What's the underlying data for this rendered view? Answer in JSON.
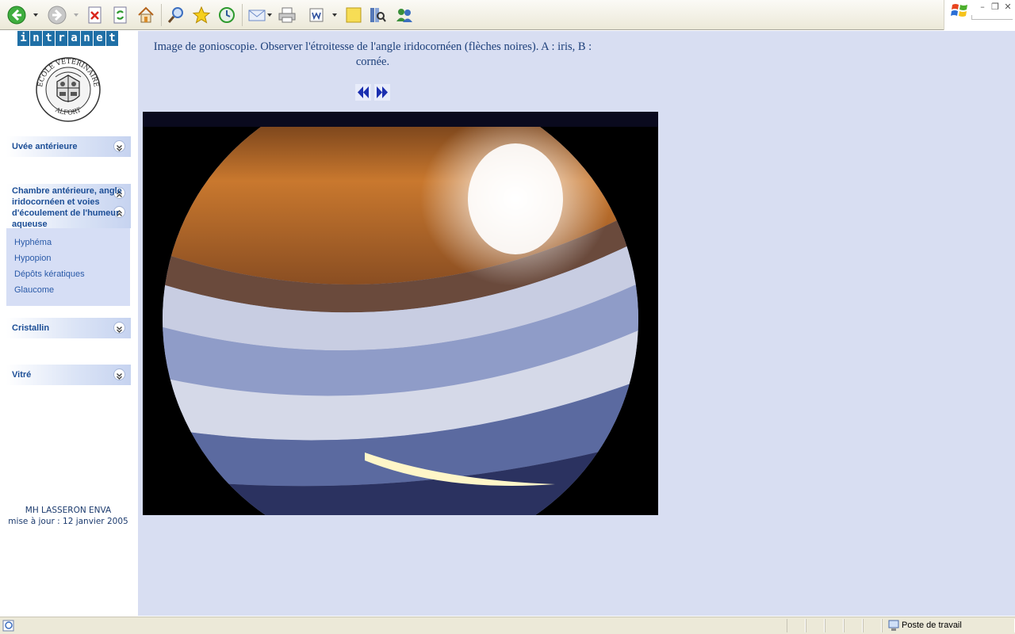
{
  "toolbar": {
    "buttons": [
      {
        "id": "back",
        "icon": "back-arrow-icon",
        "color": "#2e9a2e"
      },
      {
        "id": "forward",
        "icon": "forward-arrow-icon",
        "color": "#8c8c8c"
      },
      {
        "id": "stop",
        "icon": "stop-icon",
        "color": "#d9261c"
      },
      {
        "id": "refresh",
        "icon": "refresh-icon",
        "color": "#2e9a2e"
      },
      {
        "id": "home",
        "icon": "home-icon",
        "color": "#d98c2b"
      },
      {
        "id": "search",
        "icon": "search-icon",
        "color": "#3c6fc0"
      },
      {
        "id": "favorites",
        "icon": "star-icon",
        "color": "#f2c200"
      },
      {
        "id": "history",
        "icon": "history-icon",
        "color": "#2e9a2e"
      },
      {
        "id": "mail",
        "icon": "mail-icon",
        "color": "#6c8ac8"
      },
      {
        "id": "print",
        "icon": "printer-icon",
        "color": "#7c7c7c"
      },
      {
        "id": "edit",
        "icon": "word-edit-icon",
        "color": "#2d4f9e"
      },
      {
        "id": "discuss",
        "icon": "note-icon",
        "color": "#f2d44a"
      },
      {
        "id": "research",
        "icon": "research-icon",
        "color": "#5478b8"
      },
      {
        "id": "messenger",
        "icon": "messenger-icon",
        "color": "#3a8f3a"
      }
    ]
  },
  "sidebar": {
    "logo_letters": [
      "i",
      "n",
      "t",
      "r",
      "a",
      "n",
      "e",
      "t"
    ],
    "seal": {
      "top_text": "ECOLE VETERINAIRE",
      "bottom_text": "ALFORT"
    },
    "menus": [
      {
        "label": "Uvée antérieure"
      },
      {
        "label": "Chambre antérieure, angle iridocornéen et voies d'écoulement de l'humeur aqueuse"
      },
      {
        "label": "Cristallin"
      },
      {
        "label": "Vitré"
      }
    ],
    "submenu": [
      {
        "label": "Hyphéma"
      },
      {
        "label": "Hypopion"
      },
      {
        "label": "Dépôts kératiques"
      },
      {
        "label": "Glaucome"
      }
    ],
    "credits": {
      "author": "MH LASSERON ENVA",
      "updated": "mise à jour : 12 janvier 2005"
    }
  },
  "content": {
    "caption": "Image de gonioscopie. Observer l'étroitesse de l'angle iridocornéen (flèches noires). A : iris, B : cornée.",
    "background": "#d8def2"
  },
  "statusbar": {
    "zone": "Poste de travail"
  },
  "colors": {
    "accent": "#1c4e96",
    "logo": "#1f6fa6"
  }
}
